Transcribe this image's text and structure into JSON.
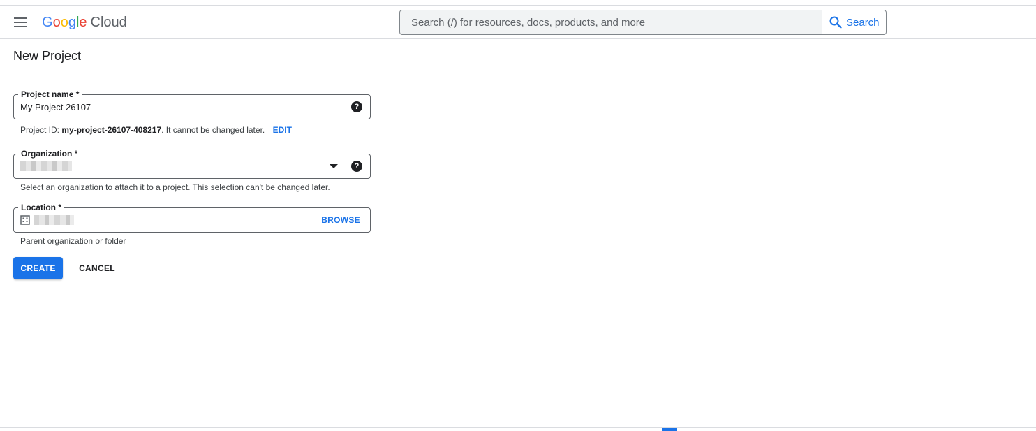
{
  "header": {
    "logo_letters": [
      "G",
      "o",
      "o",
      "g",
      "l",
      "e"
    ],
    "logo_suffix": "Cloud",
    "search_placeholder": "Search (/) for resources, docs, products, and more",
    "search_button_label": "Search"
  },
  "page": {
    "title": "New Project"
  },
  "form": {
    "project_name": {
      "label": "Project name *",
      "value": "My Project 26107",
      "hint_prefix": "Project ID: ",
      "hint_id": "my-project-26107-408217",
      "hint_suffix": ". It cannot be changed later.",
      "edit_label": "EDIT"
    },
    "organization": {
      "label": "Organization *",
      "hint": "Select an organization to attach it to a project. This selection can't be changed later."
    },
    "location": {
      "label": "Location *",
      "browse_label": "BROWSE",
      "hint": "Parent organization or folder"
    },
    "create_label": "CREATE",
    "cancel_label": "CANCEL"
  },
  "colors": {
    "primary": "#1a73e8",
    "border": "#dadce0",
    "text": "#202124"
  },
  "icons": {
    "menu": "hamburger-menu-icon",
    "search": "magnifier-icon",
    "help": "question-circle-icon",
    "dropdown": "caret-down-icon",
    "location": "building-icon"
  }
}
